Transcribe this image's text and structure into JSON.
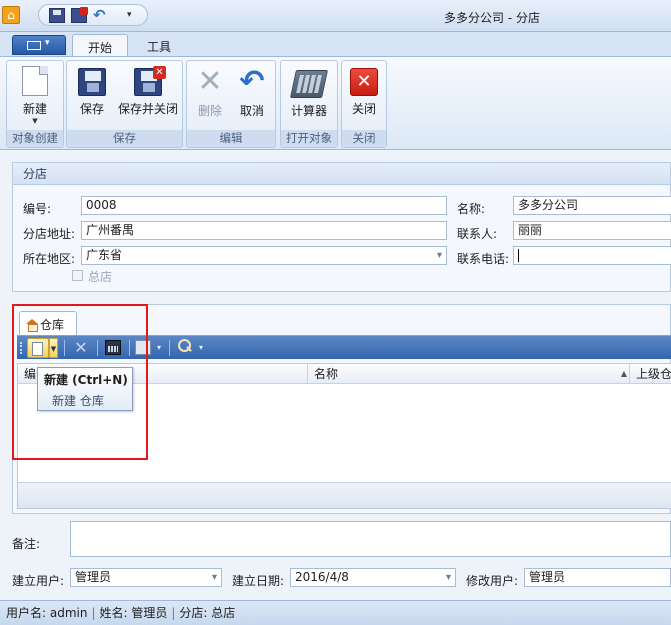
{
  "window": {
    "title": "多多分公司 - 分店"
  },
  "ribbon": {
    "tabs": [
      {
        "label": "开始"
      },
      {
        "label": "工具"
      }
    ],
    "groups": {
      "create": {
        "label": "对象创建",
        "new_label": "新建"
      },
      "save": {
        "label": "保存",
        "save_label": "保存",
        "save_close_label": "保存并关闭"
      },
      "edit": {
        "label": "编辑",
        "delete_label": "删除",
        "undo_label": "取消"
      },
      "open": {
        "label": "打开对象",
        "calc_label": "计算器"
      },
      "close": {
        "label": "关闭",
        "close_label": "关闭"
      }
    }
  },
  "branch": {
    "section_title": "分店",
    "code_label": "编号:",
    "code_value": "0008",
    "name_label": "名称:",
    "name_value": "多多分公司",
    "address_label": "分店地址:",
    "address_value": "广州番禺",
    "contact_label": "联系人:",
    "contact_value": "丽丽",
    "region_label": "所在地区:",
    "region_value": "广东省",
    "phone_label": "联系电话:",
    "phone_value": "",
    "hq_label": "总店",
    "hq_checked": false
  },
  "warehouse": {
    "tab_label": "仓库",
    "columns": {
      "code": "编号",
      "name": "名称",
      "parent": "上级仓"
    },
    "tooltip": {
      "title": "新建 (Ctrl+N)",
      "desc": "新建 仓库"
    }
  },
  "footer": {
    "remark_label": "备注:",
    "created_user_label": "建立用户:",
    "created_user_value": "管理员",
    "created_date_label": "建立日期:",
    "created_date_value": "2016/4/8",
    "modified_user_label": "修改用户:",
    "modified_user_value": "管理员"
  },
  "status": {
    "username": "用户名: admin",
    "fullname": "姓名: 管理员",
    "branch": "分店: 总店"
  },
  "colors": {
    "highlight": "#e01a1a",
    "toolbar": "#3465ad",
    "close_red": "#d12b22"
  }
}
